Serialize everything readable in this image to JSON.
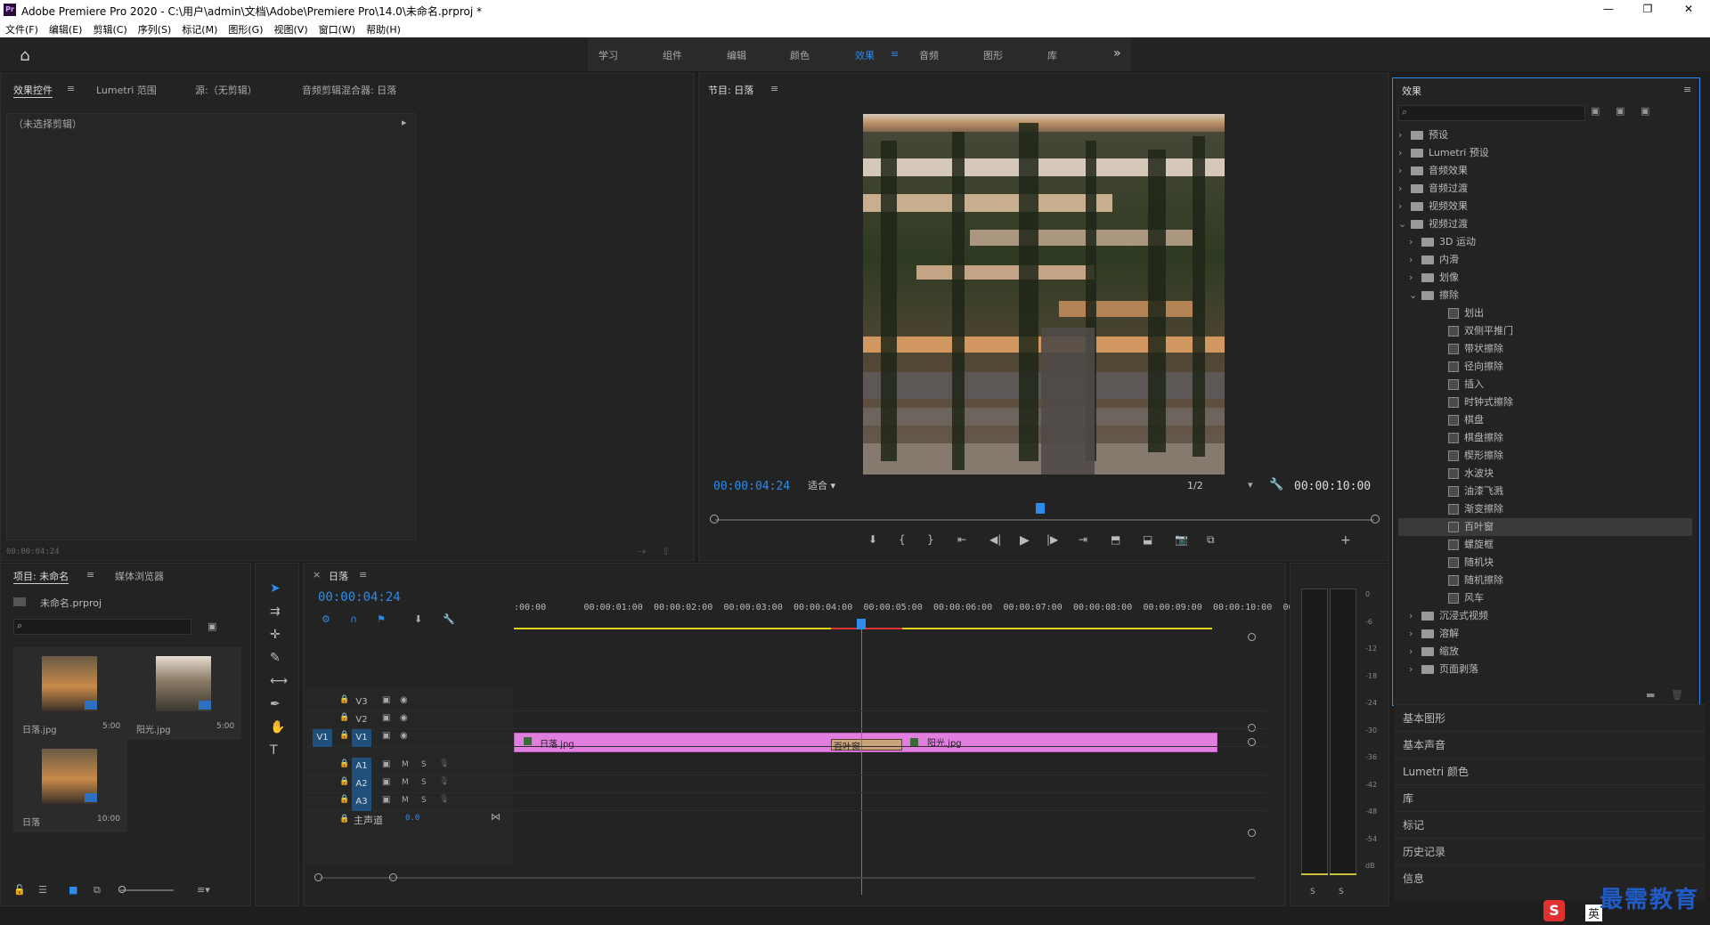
{
  "window": {
    "title": "Adobe Premiere Pro 2020 - C:\\用户\\admin\\文档\\Adobe\\Premiere Pro\\14.0\\未命名.prproj *",
    "app_icon": "Pr"
  },
  "menu": [
    "文件(F)",
    "编辑(E)",
    "剪辑(C)",
    "序列(S)",
    "标记(M)",
    "图形(G)",
    "视图(V)",
    "窗口(W)",
    "帮助(H)"
  ],
  "workspaces": [
    "学习",
    "组件",
    "编辑",
    "颜色",
    "效果",
    "音频",
    "图形",
    "库"
  ],
  "active_workspace": "效果",
  "source_panel": {
    "tabs": [
      "效果控件",
      "Lumetri 范围",
      "源:（无剪辑）",
      "音频剪辑混合器: 日落"
    ],
    "no_clip": "（未选择剪辑）",
    "timecode": "00:00:04:24"
  },
  "program_monitor": {
    "tab": "节目: 日落",
    "timecode": "00:00:04:24",
    "fit": "适合",
    "resolution": "1/2",
    "duration": "00:00:10:00"
  },
  "project_panel": {
    "tabs": [
      "项目: 未命名",
      "媒体浏览器"
    ],
    "file": "未命名.prproj",
    "items": [
      {
        "name": "日落.jpg",
        "duration": "5:00"
      },
      {
        "name": "阳光.jpg",
        "duration": "5:00"
      },
      {
        "name": "日落",
        "duration": "10:00"
      }
    ]
  },
  "timeline": {
    "tab": "日落",
    "timecode": "00:00:04:24",
    "ruler": [
      ":00:00",
      "00:00:01:00",
      "00:00:02:00",
      "00:00:03:00",
      "00:00:04:00",
      "00:00:05:00",
      "00:00:06:00",
      "00:00:07:00",
      "00:00:08:00",
      "00:00:09:00",
      "00:00:10:00",
      "00"
    ],
    "video_tracks": [
      "V3",
      "V2",
      "V1"
    ],
    "audio_tracks": [
      "A1",
      "A2",
      "A3"
    ],
    "source_patch": "V1",
    "master": "主声道",
    "master_value": "0.0",
    "clips": {
      "clip1": "日落.jpg",
      "transition": "百叶窗",
      "clip2": "阳光.jpg"
    },
    "m_label": "M",
    "s_label": "S",
    "playhead_fraction": 0.497
  },
  "audio_meter": {
    "scale": [
      "0",
      "-6",
      "-12",
      "-18",
      "-24",
      "-30",
      "-36",
      "-42",
      "-48",
      "-54",
      "dB"
    ],
    "solo": [
      "S",
      "S"
    ]
  },
  "effects_panel": {
    "title": "效果",
    "tree": [
      {
        "label": "预设",
        "type": "folder",
        "level": 0,
        "open": false
      },
      {
        "label": "Lumetri 预设",
        "type": "folder",
        "level": 0,
        "open": false
      },
      {
        "label": "音频效果",
        "type": "folder",
        "level": 0,
        "open": false
      },
      {
        "label": "音频过渡",
        "type": "folder",
        "level": 0,
        "open": false
      },
      {
        "label": "视频效果",
        "type": "folder",
        "level": 0,
        "open": false
      },
      {
        "label": "视频过渡",
        "type": "folder",
        "level": 0,
        "open": true
      },
      {
        "label": "3D 运动",
        "type": "folder",
        "level": 1,
        "open": false
      },
      {
        "label": "内滑",
        "type": "folder",
        "level": 1,
        "open": false
      },
      {
        "label": "划像",
        "type": "folder",
        "level": 1,
        "open": false
      },
      {
        "label": "擦除",
        "type": "folder",
        "level": 1,
        "open": true
      },
      {
        "label": "划出",
        "type": "fx",
        "level": 2
      },
      {
        "label": "双侧平推门",
        "type": "fx",
        "level": 2
      },
      {
        "label": "带状擦除",
        "type": "fx",
        "level": 2
      },
      {
        "label": "径向擦除",
        "type": "fx",
        "level": 2
      },
      {
        "label": "插入",
        "type": "fx",
        "level": 2
      },
      {
        "label": "时钟式擦除",
        "type": "fx",
        "level": 2
      },
      {
        "label": "棋盘",
        "type": "fx",
        "level": 2
      },
      {
        "label": "棋盘擦除",
        "type": "fx",
        "level": 2
      },
      {
        "label": "楔形擦除",
        "type": "fx",
        "level": 2
      },
      {
        "label": "水波块",
        "type": "fx",
        "level": 2
      },
      {
        "label": "油漆飞溅",
        "type": "fx",
        "level": 2
      },
      {
        "label": "渐变擦除",
        "type": "fx",
        "level": 2
      },
      {
        "label": "百叶窗",
        "type": "fx",
        "level": 2,
        "selected": true
      },
      {
        "label": "螺旋框",
        "type": "fx",
        "level": 2
      },
      {
        "label": "随机块",
        "type": "fx",
        "level": 2
      },
      {
        "label": "随机擦除",
        "type": "fx",
        "level": 2
      },
      {
        "label": "风车",
        "type": "fx",
        "level": 2
      },
      {
        "label": "沉浸式视频",
        "type": "folder",
        "level": 1,
        "open": false
      },
      {
        "label": "溶解",
        "type": "folder",
        "level": 1,
        "open": false
      },
      {
        "label": "缩放",
        "type": "folder",
        "level": 1,
        "open": false
      },
      {
        "label": "页面剥落",
        "type": "folder",
        "level": 1,
        "open": false
      }
    ]
  },
  "side_panels": [
    "基本图形",
    "基本声音",
    "Lumetri 颜色",
    "库",
    "标记",
    "历史记录",
    "信息"
  ],
  "watermark": "最需教育",
  "ime": {
    "logo": "S",
    "lang": "英"
  },
  "colors": {
    "accent": "#2d8ceb",
    "clip": "#e27ee0",
    "transition": "#c9a37c",
    "yellow": "#e3d21c"
  }
}
